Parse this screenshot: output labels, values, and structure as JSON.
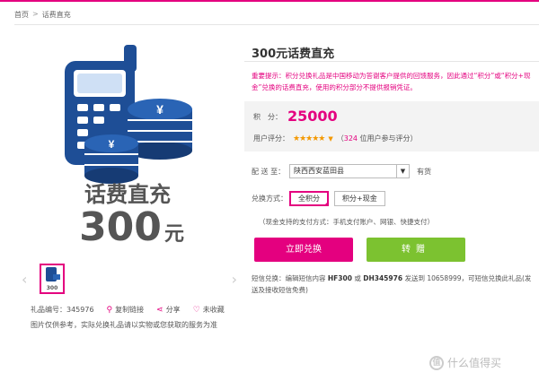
{
  "breadcrumb": {
    "home": "首页",
    "separator": ">",
    "current": "话费直充"
  },
  "product": {
    "image_text_line1": "话费直充",
    "image_amount": "300",
    "image_unit": "元",
    "thumb_text": "300",
    "gift_no_label": "礼品编号：345976",
    "copy_link": "复制链接",
    "share": "分享",
    "favorite": "未收藏",
    "note": "图片仅供参考，实际兑换礼品请以实物或您获取的服务为准"
  },
  "detail": {
    "title": "300元话费直充",
    "notice": "重要提示：积分兑换礼品是中国移动为答谢客户提供的回馈服务，因此通过“积分”或“积分+现金”兑换的话费直充，使用的积分部分不提供报销凭证。",
    "points_label": "积　分：",
    "points_value": "25000",
    "rating_label": "用户评分：",
    "rating_stars": "★★★★★",
    "rating_count_prefix": "（",
    "rating_count": "324",
    "rating_count_suffix": " 位用户参与评分）",
    "ship_label": "配 送 至：",
    "ship_value": "陕西西安蓝田县",
    "ship_stock": "有货",
    "method_label": "兑换方式：",
    "method_options": [
      "全积分",
      "积分+现金"
    ],
    "pay_note": "（现金支持的支付方式：手机支付账户、网银、快捷支付）",
    "redeem_button": "立即兑换",
    "gift_button": "转赠",
    "sms_prefix": "短信兑换：编辑短信内容 ",
    "sms_code1": "HF300",
    "sms_or": " 或 ",
    "sms_code2": "DH345976",
    "sms_suffix": " 发送到 10658999，可短信兑换此礼品(发送及接收短信免费)"
  },
  "watermark": {
    "text": "什么值得买",
    "logo": "值"
  },
  "colors": {
    "brand": "#e4007f",
    "green": "#7cc230",
    "star": "#f39800",
    "phone_blue": "#1e4e96"
  }
}
